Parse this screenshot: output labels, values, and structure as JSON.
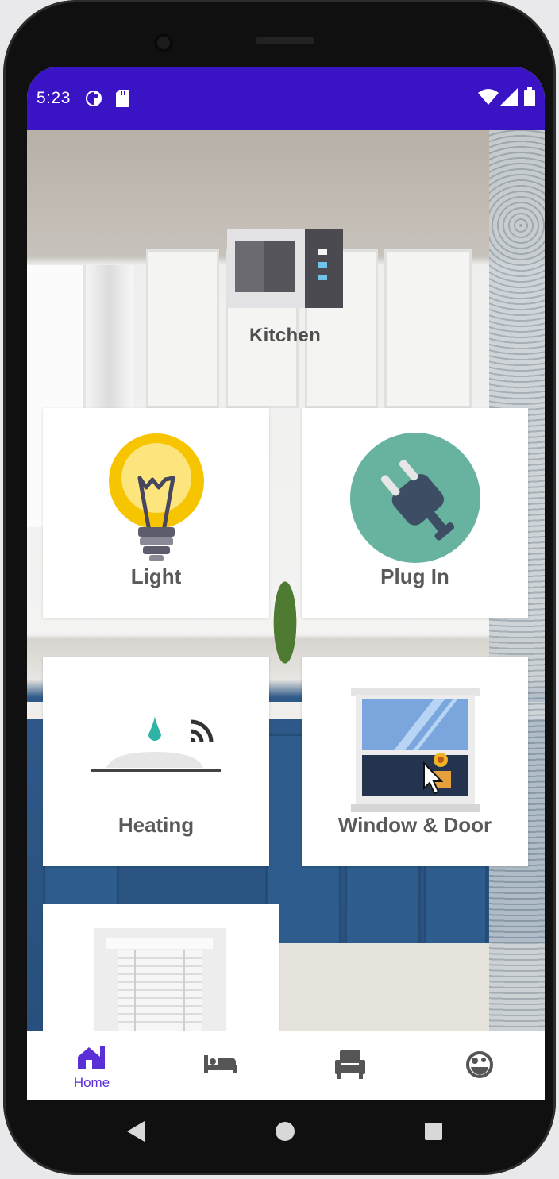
{
  "status_bar": {
    "time": "5:23",
    "background": "#3a13c4",
    "left_icons": [
      "theme-icon",
      "sd-card-icon"
    ],
    "right_icons": [
      "wifi-icon",
      "cell-signal-icon",
      "battery-icon"
    ]
  },
  "room": {
    "title": "Kitchen",
    "icon": "microwave-icon"
  },
  "tiles": [
    {
      "label": "Light",
      "icon": "light-bulb-icon"
    },
    {
      "label": "Plug In",
      "icon": "plug-icon"
    },
    {
      "label": "Heating",
      "icon": "heating-icon"
    },
    {
      "label": "Window & Door",
      "icon": "window-icon"
    },
    {
      "label": "",
      "icon": "blinds-icon"
    }
  ],
  "bottom_nav": {
    "items": [
      {
        "label": "Home",
        "icon": "home-icon",
        "selected": true
      },
      {
        "label": "",
        "icon": "bed-icon",
        "selected": false
      },
      {
        "label": "",
        "icon": "armchair-icon",
        "selected": false
      },
      {
        "label": "",
        "icon": "settings-icon",
        "selected": false
      }
    ],
    "accent": "#5b2fd6"
  },
  "system_nav": [
    "back-icon",
    "home-circle-icon",
    "recents-icon"
  ]
}
